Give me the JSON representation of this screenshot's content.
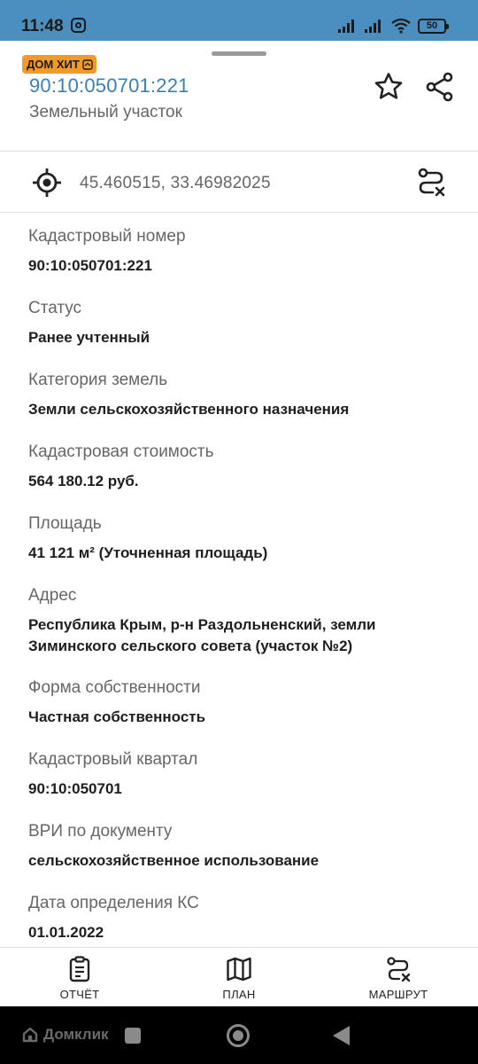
{
  "status_bar": {
    "time": "11:48",
    "battery": "50",
    "icons": [
      "instagram-icon",
      "signal-icon",
      "wifi-icon",
      "battery-icon"
    ]
  },
  "header": {
    "badge": "ДОМ ХИТ",
    "cadastral_title": "90:10:050701:221",
    "object_type": "Земельный участок",
    "icons": [
      "star-icon",
      "share-icon"
    ]
  },
  "coordinates": {
    "value": "45.460515, 33.46982025",
    "icons": [
      "target-icon",
      "route-icon"
    ]
  },
  "details": [
    {
      "label": "Кадастровый номер",
      "value": "90:10:050701:221"
    },
    {
      "label": "Статус",
      "value": "Ранее учтенный"
    },
    {
      "label": "Категория земель",
      "value": "Земли сельскохозяйственного назначения"
    },
    {
      "label": "Кадастровая стоимость",
      "value": "564 180.12 руб."
    },
    {
      "label": "Площадь",
      "value": "41 121 м² (Уточненная площадь)"
    },
    {
      "label": "Адрес",
      "value": "Республика Крым, р-н Раздольненский, земли Зиминского сельского совета (участок №2)"
    },
    {
      "label": "Форма собственности",
      "value": "Частная собственность"
    },
    {
      "label": "Кадастровый квартал",
      "value": "90:10:050701"
    },
    {
      "label": "ВРИ по документу",
      "value": "сельскохозяйственное использование"
    },
    {
      "label": "Дата определения КС",
      "value": "01.01.2022"
    }
  ],
  "bottom_actions": [
    {
      "label": "ОТЧЁТ",
      "icon": "report-icon"
    },
    {
      "label": "ПЛАН",
      "icon": "map-icon"
    },
    {
      "label": "МАРШРУТ",
      "icon": "route-icon"
    }
  ],
  "system_nav": {
    "brand": "Домклик"
  },
  "colors": {
    "status_bar": "#4a8fc0",
    "accent_link": "#3a7fb6",
    "badge": "#f39a26",
    "label_gray": "#666666",
    "nav_bar": "#000000"
  }
}
